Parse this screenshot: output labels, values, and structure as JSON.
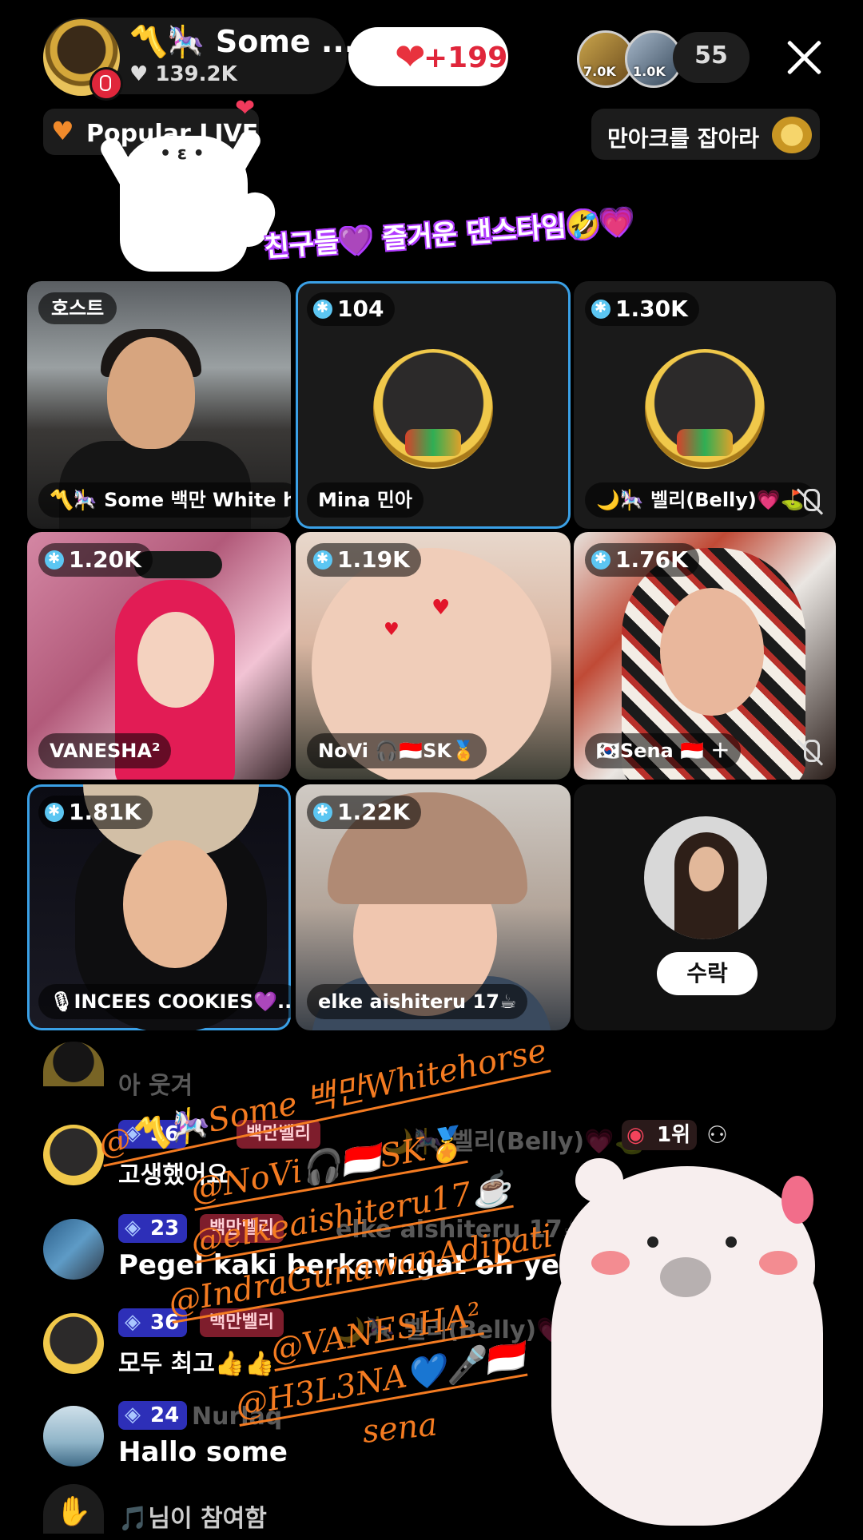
{
  "header": {
    "host_name": "〽️🎠 Some ...",
    "host_likes": "♥ 139.2K",
    "like_button": {
      "icon": "heart-icon",
      "label": "+199"
    },
    "top_viewers": [
      "7.0K",
      "1.0K"
    ],
    "viewer_count": "55"
  },
  "popular": {
    "label": "Popular LIVE"
  },
  "mission": {
    "label": "만아크를 잡아라"
  },
  "banner": {
    "text": "친구들💜 즐거운 댄스타임🤣💗"
  },
  "grid": {
    "host_tag": "호스트",
    "tiles": [
      {
        "badge": "",
        "name": "〽️🎠 Some 백만 White ho..."
      },
      {
        "badge": "104",
        "name": "Mina 민아"
      },
      {
        "badge": "1.30K",
        "name": "🌙🎠 벨리(Belly)💗⛳"
      },
      {
        "badge": "1.20K",
        "name": "VANESHA²"
      },
      {
        "badge": "1.19K",
        "name": "NoVi 🎧🇮🇩SK🏅"
      },
      {
        "badge": "1.76K",
        "name": "🇰🇷Sena 🇮🇩 ＋"
      },
      {
        "badge": "1.81K",
        "name": "🎙INCEES COOKIES💜..."
      },
      {
        "badge": "1.22K",
        "name": "elke aishiteru 17☕"
      }
    ],
    "accept_button": "수락"
  },
  "chat": {
    "items": [
      {
        "level": "",
        "fan": "",
        "user": "",
        "text": "아 웃겨"
      },
      {
        "level": "36",
        "fan": "백만벨리",
        "user": "🌙🎠 벨리(Belly)💗⛳",
        "text": "고생했어요",
        "rank": "1위"
      },
      {
        "level": "23",
        "fan": "백만벨리",
        "user": "elke aishiteru 17☕",
        "text": "Pegel kaki berkeringat oh ye 😄"
      },
      {
        "level": "36",
        "fan": "백만벨리",
        "user": "🌙🎠 벨리(Belly)💗⛳",
        "text": "모두 최고👍👍"
      },
      {
        "level": "24",
        "fan": "",
        "user": "Nurlaq",
        "text": "Hallo some"
      },
      {
        "level": "",
        "fan": "",
        "user": "",
        "text": "🎵님이 참여함"
      }
    ]
  },
  "overlay_tags": [
    "@〽️🎠Some 백만Whitehorse",
    "@NoVi🎧🇮🇩SK🏅",
    "@elkeaishiteru17☕",
    "@IndraGunawanAdipati",
    "@VANESHA²",
    "@H3L3NA💙🎤🇮🇩",
    "sena"
  ],
  "colors": {
    "accent_blue": "#3aa0e6",
    "like_red": "#e0263b",
    "tag_orange": "#f47b21"
  }
}
